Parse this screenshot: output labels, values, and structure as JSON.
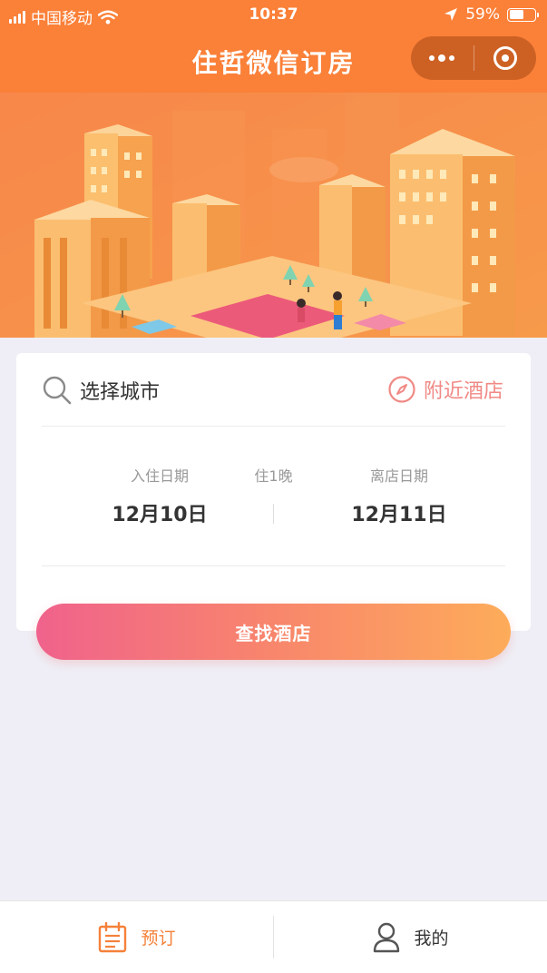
{
  "status_bar": {
    "carrier": "中国移动",
    "time": "10:37",
    "battery": "59%",
    "battery_level": 0.59
  },
  "nav": {
    "title": "住哲微信订房",
    "more_icon": "more-dots-icon",
    "close_icon": "target-circle-icon"
  },
  "search": {
    "city_label": "选择城市",
    "city_icon": "search-icon",
    "nearby_label": "附近酒店",
    "nearby_icon": "compass-icon"
  },
  "dates": {
    "checkin_caption": "入住日期",
    "checkin_value": "12月10日",
    "nights": "住1晚",
    "checkout_caption": "离店日期",
    "checkout_value": "12月11日"
  },
  "actions": {
    "search_button": "查找酒店"
  },
  "tabs": [
    {
      "label": "预订",
      "icon": "calendar-icon",
      "active": true
    },
    {
      "label": "我的",
      "icon": "user-icon",
      "active": false
    }
  ],
  "colors": {
    "brand_orange": "#fb8038",
    "accent_pink": "#f0628c",
    "accent_gold": "#fdac5a",
    "nearby_text": "#f08a86",
    "active_tab": "#f5813a",
    "page_bg": "#efeef6"
  }
}
